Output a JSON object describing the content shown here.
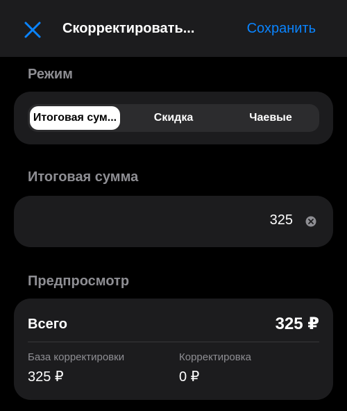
{
  "header": {
    "title": "Скорректировать...",
    "save_label": "Сохранить",
    "close_icon": "close-icon",
    "accent_color": "#0a84ff"
  },
  "mode": {
    "label": "Режим",
    "options": [
      "Итоговая сум...",
      "Скидка",
      "Чаевые"
    ],
    "selected": "Итоговая сум..."
  },
  "amount": {
    "label": "Итоговая сумма",
    "value": "325",
    "clear_icon": "clear-icon"
  },
  "preview": {
    "label": "Предпросмотр",
    "total_label": "Всего",
    "total_value": "325 ₽",
    "base_label": "База корректировки",
    "base_value": "325 ₽",
    "adjustment_label": "Корректировка",
    "adjustment_value": "0 ₽"
  }
}
